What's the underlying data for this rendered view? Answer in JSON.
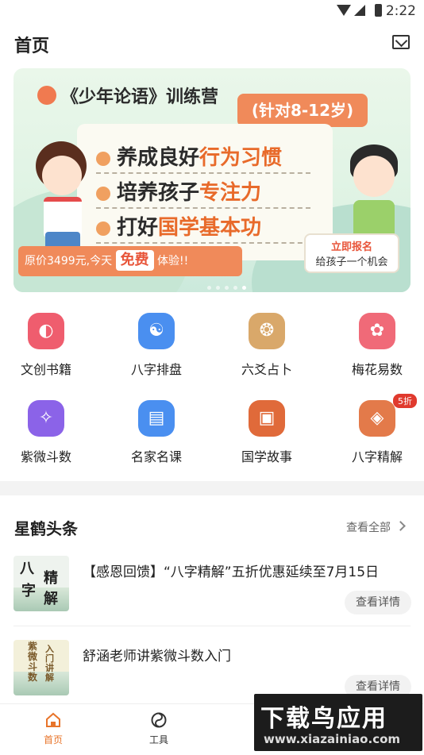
{
  "status_bar": {
    "time": "2:22"
  },
  "header": {
    "title": "首页"
  },
  "banner": {
    "title": "《少年论语》训练营",
    "age_range": "(针对8-12岁)",
    "lines": [
      {
        "plain": "养成良好",
        "highlight": "行为习惯"
      },
      {
        "plain": "培养孩子",
        "highlight": "专注力"
      },
      {
        "plain": "打好",
        "highlight": "国学基本功"
      }
    ],
    "price_text": "原价3499元,今天",
    "free_text": "免费",
    "trial_text": "体验!!",
    "signup_line1": "立即报名",
    "signup_line2": "给孩子一个机会",
    "page_count": 5,
    "active_page": 4
  },
  "features": [
    {
      "label": "文创书籍",
      "icon": "planet-icon",
      "color": "#ef5d6e"
    },
    {
      "label": "八字排盘",
      "icon": "yin-yang-icon",
      "color": "#4a8ff0"
    },
    {
      "label": "六爻占卜",
      "icon": "coins-icon",
      "color": "#d9a86a"
    },
    {
      "label": "梅花易数",
      "icon": "plum-blossom-icon",
      "color": "#f06a78"
    },
    {
      "label": "紫微斗数",
      "icon": "constellation-icon",
      "color": "#8b63e8"
    },
    {
      "label": "名家名课",
      "icon": "book-icon",
      "color": "#4a8ff0"
    },
    {
      "label": "国学故事",
      "icon": "story-card-icon",
      "color": "#e06a3a"
    },
    {
      "label": "八字精解",
      "icon": "chart-badge-icon",
      "color": "#e37a4a",
      "badge": "5折"
    }
  ],
  "news_section": {
    "title": "星鹤头条",
    "see_all": "查看全部",
    "items": [
      {
        "title": "【感恩回馈】“八字精解”五折优惠延续至7月15日",
        "button": "查看详情",
        "thumb_text": [
          "八",
          "字",
          "精",
          "解"
        ]
      },
      {
        "title": "舒涵老师讲紫微斗数入门",
        "button": "查看详情",
        "thumb_text": [
          "紫微斗数",
          "入门讲解"
        ]
      }
    ]
  },
  "tabbar": {
    "tabs": [
      {
        "label": "首页",
        "active": true,
        "color": "#e8742a"
      },
      {
        "label": "工具",
        "active": false,
        "color": "#333333"
      }
    ]
  },
  "watermark": {
    "line1": "下载鸟应用",
    "line2": "www.xiazainiao.com"
  }
}
